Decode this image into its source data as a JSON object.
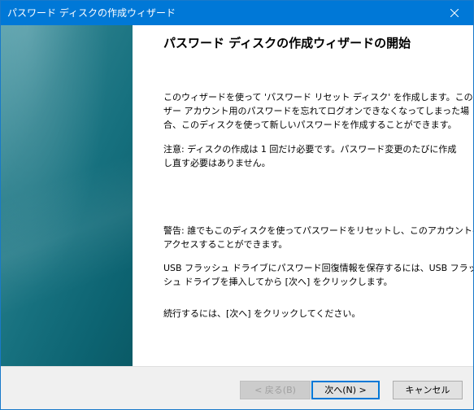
{
  "window": {
    "title": "パスワード ディスクの作成ウィザード"
  },
  "content": {
    "heading": "パスワード ディスクの作成ウィザードの開始",
    "para1": [
      "このウィザードを使って 'パスワード リセット ディスク' を作成します。このユー",
      "ザー アカウント用のパスワードを忘れてログオンできなくなってしまった場",
      "合、このディスクを使って新しいパスワードを作成することができます。"
    ],
    "para2": [
      "注意: ディスクの作成は 1 回だけ必要です。パスワード変更のたびに作成",
      "し直す必要はありません。"
    ],
    "para3": [
      "警告: 誰でもこのディスクを使ってパスワードをリセットし、このアカウントへ",
      "アクセスすることができます。"
    ],
    "para4": [
      "USB フラッシュ ドライブにパスワード回復情報を保存するには、USB フラッ",
      "シュ ドライブを挿入してから [次へ] をクリックします。"
    ],
    "para5": [
      "続行するには、[次へ] をクリックしてください。"
    ]
  },
  "buttons": {
    "back": "< 戻る(B)",
    "next": "次へ(N) >",
    "cancel": "キャンセル"
  },
  "icons": {
    "close": "close-icon"
  },
  "colors": {
    "titlebar": "#0078d7",
    "panel": "#17717f",
    "focus": "#0078d7"
  }
}
